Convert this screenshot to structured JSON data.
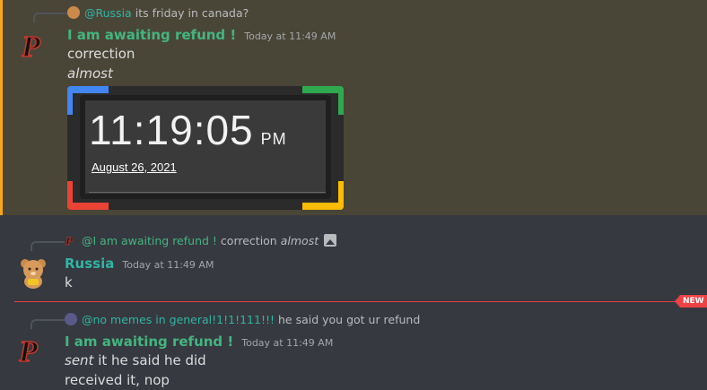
{
  "msg1": {
    "reply": {
      "mention": "@Russia",
      "text": "its friday in canada?"
    },
    "author": "I am awaiting refund !",
    "author_color": "#43b581",
    "timestamp": "Today at 11:49 AM",
    "lines": [
      "correction",
      "almost"
    ],
    "embed": {
      "time": "11:19:05",
      "ampm": "PM",
      "date": "August 26, 2021"
    }
  },
  "msg2": {
    "reply": {
      "mention": "@I am awaiting refund !",
      "text": "correction",
      "italic": "almost"
    },
    "author": "Russia",
    "author_color": "#2fb5a6",
    "timestamp": "Today at 11:49 AM",
    "lines": [
      "k"
    ]
  },
  "divider": {
    "label": "NEW"
  },
  "msg3": {
    "reply": {
      "mention": "@no memes in general!1!1!111!!!",
      "text": "he said you got ur refund"
    },
    "author": "I am awaiting refund !",
    "author_color": "#43b581",
    "timestamp": "Today at 11:49 AM",
    "line1_italic": "sent",
    "line1_rest": " it he said he did",
    "line2": "received it, nop"
  }
}
